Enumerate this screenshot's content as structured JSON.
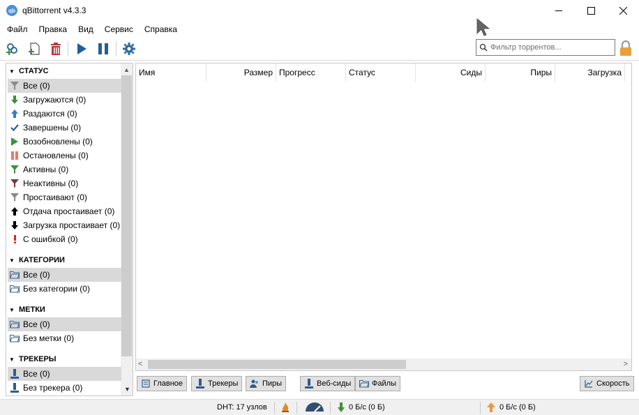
{
  "window": {
    "title": "qBittorrent v4.3.3",
    "app_icon_label": "qb"
  },
  "menu": [
    "Файл",
    "Правка",
    "Вид",
    "Сервис",
    "Справка"
  ],
  "toolbar": {
    "buttons": [
      "add-link-icon",
      "add-file-icon",
      "delete-icon",
      "resume-icon",
      "pause-icon",
      "settings-icon"
    ],
    "filter_placeholder": "Фильтр торрентов..."
  },
  "sidebar": {
    "status": {
      "header": "СТАТУС",
      "items": [
        {
          "label": "Все (0)",
          "icon": "filter-gray-icon",
          "selected": true
        },
        {
          "label": "Загружаются (0)",
          "icon": "arrow-down-green-icon"
        },
        {
          "label": "Раздаются (0)",
          "icon": "arrow-up-blue-icon"
        },
        {
          "label": "Завершены (0)",
          "icon": "check-icon"
        },
        {
          "label": "Возобновлены (0)",
          "icon": "play-green-icon"
        },
        {
          "label": "Остановлены (0)",
          "icon": "pause-red-icon"
        },
        {
          "label": "Активны (0)",
          "icon": "filter-green-icon"
        },
        {
          "label": "Неактивны (0)",
          "icon": "filter-red-icon"
        },
        {
          "label": "Простаивают (0)",
          "icon": "filter-gray-icon"
        },
        {
          "label": "Отдача простаивает (0)",
          "icon": "arrow-up-black-icon"
        },
        {
          "label": "Загрузка простаивает (0)",
          "icon": "arrow-down-black-icon"
        },
        {
          "label": "С ошибкой (0)",
          "icon": "error-icon"
        }
      ]
    },
    "categories": {
      "header": "КАТЕГОРИИ",
      "items": [
        {
          "label": "Все (0)",
          "icon": "folder-icon",
          "selected": true
        },
        {
          "label": "Без категории (0)",
          "icon": "folder-icon"
        }
      ]
    },
    "tags": {
      "header": "МЕТКИ",
      "items": [
        {
          "label": "Все (0)",
          "icon": "folder-icon",
          "selected": true
        },
        {
          "label": "Без метки (0)",
          "icon": "folder-icon"
        }
      ]
    },
    "trackers": {
      "header": "ТРЕКЕРЫ",
      "items": [
        {
          "label": "Все (0)",
          "icon": "tracker-icon",
          "selected": true
        },
        {
          "label": "Без трекера (0)",
          "icon": "tracker-icon"
        }
      ]
    }
  },
  "table": {
    "columns": [
      "Имя",
      "Размер",
      "Прогресс",
      "Статус",
      "Сиды",
      "Пиры",
      "Загрузка"
    ]
  },
  "tabs": {
    "general": "Главное",
    "trackers": "Трекеры",
    "peers": "Пиры",
    "webseeds": "Веб-сиды",
    "files": "Файлы",
    "speed": "Скорость"
  },
  "status_bar": {
    "dht": "DHT: 17 узлов",
    "download": "0 Б/с (0 Б)",
    "upload": "0 Б/с (0 Б)"
  },
  "colors": {
    "selected_row": "#d9d9d9",
    "download_green": "#3f8f3a",
    "upload_orange": "#e79a3a",
    "delete_red": "#b33a3a",
    "play_blue": "#1f5f9e",
    "lock_orange": "#e7a13a"
  }
}
